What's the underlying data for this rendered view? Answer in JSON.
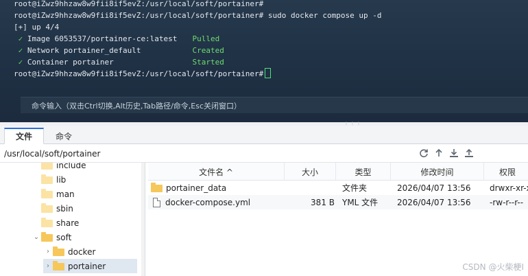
{
  "terminal": {
    "prompt": "root@iZwz9hhzaw8w9fii8if5evZ:/usr/local/soft/portainer#",
    "command": "sudo docker compose up -d",
    "progress": "[+] up 4/4",
    "tasks": [
      {
        "check": "✓",
        "name": "Image 6053537/portainer-ce:latest",
        "status": "Pulled"
      },
      {
        "check": "✓",
        "name": "Network portainer_default",
        "status": "Created"
      },
      {
        "check": "✓",
        "name": "Container portainer",
        "status": "Started"
      }
    ],
    "command_hint": "命令输入（双击Ctrl切换,Alt历史,Tab路径/命令,Esc关闭窗口）"
  },
  "tabs": [
    {
      "label": "文件",
      "active": true
    },
    {
      "label": "命令",
      "active": false
    }
  ],
  "pathbar": {
    "path": "/usr/local/soft/portainer"
  },
  "tree": {
    "items": [
      {
        "label": "include",
        "depth": 1,
        "chevron": ""
      },
      {
        "label": "lib",
        "depth": 1,
        "chevron": ""
      },
      {
        "label": "man",
        "depth": 1,
        "chevron": ""
      },
      {
        "label": "sbin",
        "depth": 1,
        "chevron": ""
      },
      {
        "label": "share",
        "depth": 1,
        "chevron": ""
      },
      {
        "label": "soft",
        "depth": 1,
        "chevron": "⌄"
      },
      {
        "label": "docker",
        "depth": 2,
        "chevron": "›"
      },
      {
        "label": "portainer",
        "depth": 2,
        "chevron": "›"
      }
    ]
  },
  "filelist": {
    "columns": [
      "文件名 ^",
      "大小",
      "类型",
      "修改时间",
      "权限"
    ],
    "rows": [
      {
        "icon": "folder-icon",
        "name": "portainer_data",
        "size": "",
        "type": "文件夹",
        "modified": "2026/04/07 13:56",
        "perm": "drwxr-xr-x"
      },
      {
        "icon": "file-icon",
        "name": "docker-compose.yml",
        "size": "381 B",
        "type": "YML 文件",
        "modified": "2026/04/07 13:56",
        "perm": "-rw-r--r--"
      }
    ]
  },
  "watermark": "CSDN @火柴梗I",
  "colors": {
    "accent": "#2c6ed5",
    "success": "#5fd75f",
    "folder": "#f6c75a",
    "terminal_bg": "#203246"
  }
}
